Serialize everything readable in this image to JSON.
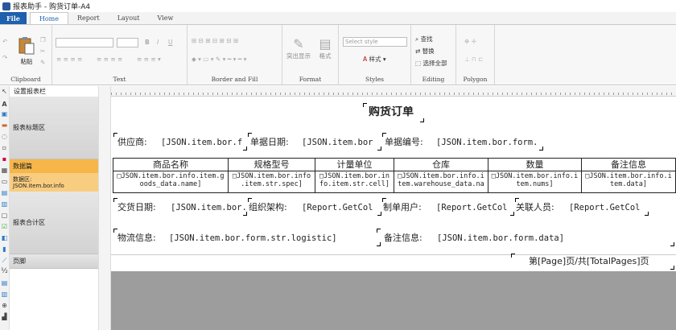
{
  "titlebar": {
    "title": "报表助手 - 购货订单-A4"
  },
  "menu": {
    "file": "File",
    "tabs": [
      "Home",
      "Report",
      "Layout",
      "View"
    ]
  },
  "ribbon": {
    "clipboard": {
      "label": "Clipboard",
      "paste": "粘贴"
    },
    "text": {
      "label": "Text",
      "bold": "B",
      "italic": "I",
      "underline": "U"
    },
    "border": {
      "label": "Border and Fill"
    },
    "format": {
      "label": "Format",
      "highlight": "突出显示",
      "format_btn": "格式"
    },
    "styles": {
      "label": "Styles",
      "select_placeholder": "Select style",
      "style_btn": "样式"
    },
    "editing": {
      "label": "Editing",
      "find": "查找",
      "replace": "替换",
      "select_all": "选择全部"
    },
    "polygon": {
      "label": "Polygon"
    }
  },
  "bands": {
    "header": "设置报表栏",
    "title": "报表标题区",
    "data": "数据篇",
    "data_sub1": "数据区:",
    "data_sub2": "JSON.item.bor.info",
    "total": "报表合计区",
    "footer": "页脚"
  },
  "report": {
    "title": "购货订单",
    "supplier_label": "供应商:",
    "supplier_value": "[JSON.item.bor.f",
    "date_label": "单据日期:",
    "date_value": "[JSON.item.bor",
    "docno_label": "单据编号:",
    "docno_value": "[JSON.item.bor.form.",
    "columns": [
      "商品名称",
      "规格型号",
      "计量单位",
      "仓库",
      "数量",
      "备注信息"
    ],
    "cells": [
      "□JSON.item.bor.info.item.g oods_data.name]",
      "□JSON.item.bor.info .item.str.spec]",
      "□JSON.item.bor.in fo.item.str.cell]",
      "□JSON.item.bor.info.i tem.warehouse_data.na",
      "□JSON.item.bor.info.i tem.nums]",
      "□JSON.item.bor.info.i tem.data]"
    ],
    "delivery_label": "交货日期:",
    "delivery_value": "[JSON.item.bor.",
    "org_label": "组织架构:",
    "org_value": "[Report.GetCol",
    "maker_label": "制单用户:",
    "maker_value": "[Report.GetCol",
    "contact_label": "关联人员:",
    "contact_value": "[Report.GetCol",
    "logistic_label": "物流信息:",
    "logistic_value": "[JSON.item.bor.form.str.logistic]",
    "note_label": "备注信息:",
    "note_value": "[JSON.item.bor.form.data]",
    "page_text": "第[Page]页/共[TotalPages]页"
  },
  "colors": {
    "file_tab": "#1e5fae",
    "band_selected": "#f6b64a",
    "band_sub": "#f9cd80",
    "canvas_bg": "#9d9d9d"
  }
}
